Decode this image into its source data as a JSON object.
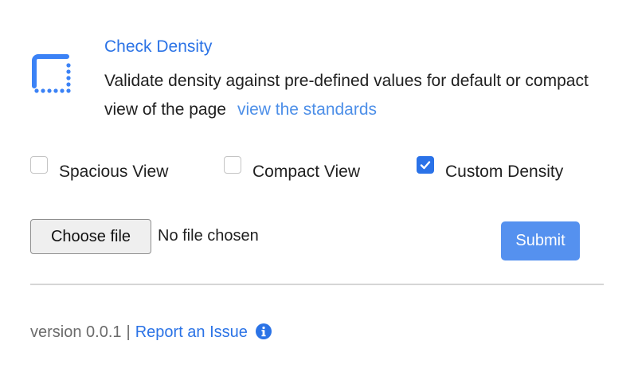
{
  "header": {
    "icon": "density-frame-icon",
    "title": "Check Density",
    "description": "Validate density against pre-defined values for default or compact view of the page",
    "standards_link": "view the standards"
  },
  "options": [
    {
      "label": "Spacious View",
      "checked": false
    },
    {
      "label": "Compact View",
      "checked": false
    },
    {
      "label": "Custom Density",
      "checked": true
    }
  ],
  "file_input": {
    "button_label": "Choose file",
    "status": "No file chosen"
  },
  "submit_label": "Submit",
  "footer": {
    "version": "version 0.0.1",
    "separator": "|",
    "report_link": "Report an Issue",
    "info_icon": "info-icon"
  },
  "colors": {
    "link": "#2b73e6",
    "accent": "#2a72e8",
    "submit_bg": "#5591ef"
  }
}
